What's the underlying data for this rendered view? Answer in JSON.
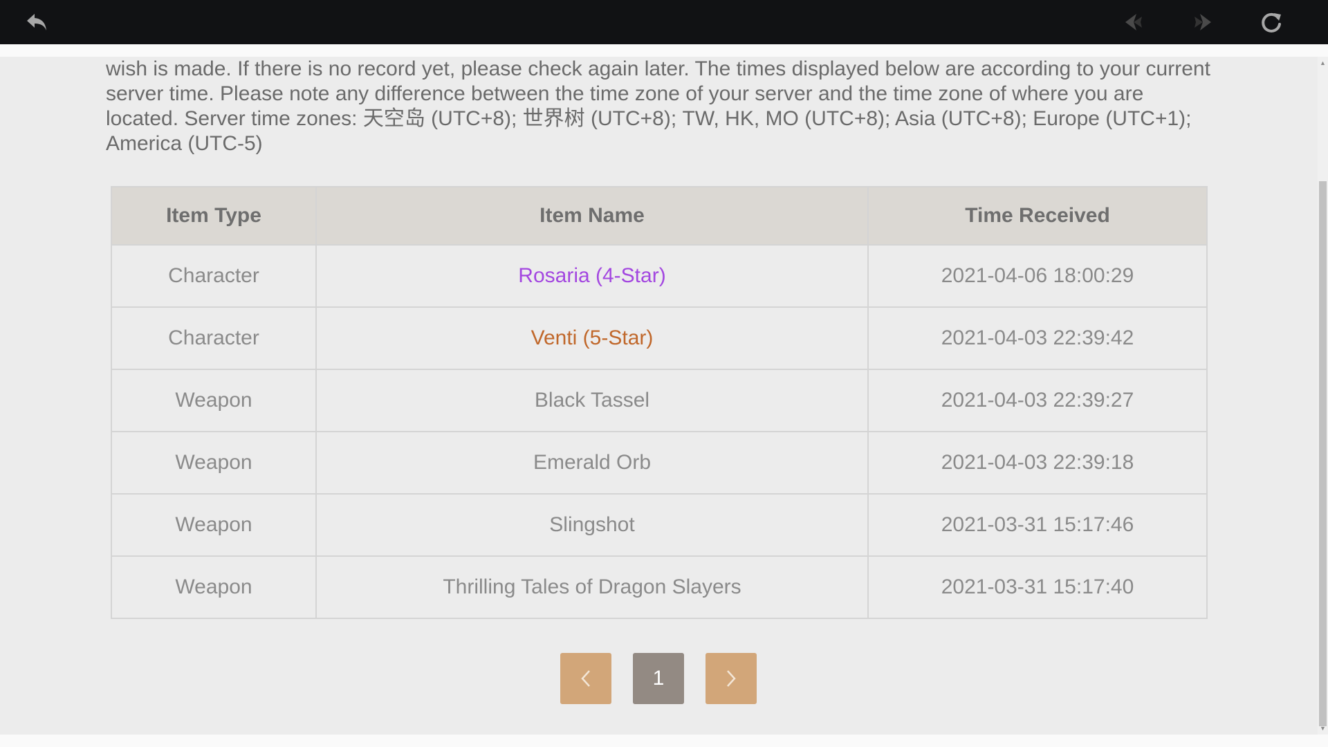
{
  "toolbar": {
    "back_icon": "back-arrow-icon",
    "prev_icon": "arrow-left-icon",
    "next_icon": "arrow-right-icon",
    "reload_icon": "reload-icon",
    "icon_color": "#a7a7a7",
    "bar_color": "#111214"
  },
  "intro_text": "wish is made. If there is no record yet, please check again later. The times displayed below are according to your current server time. Please note any difference between the time zone of your server and the time zone of where you are located. Server time zones: 天空岛 (UTC+8); 世界树 (UTC+8); TW, HK, MO (UTC+8); Asia (UTC+8); Europe (UTC+1); America (UTC-5)",
  "table": {
    "headers": [
      "Item Type",
      "Item Name",
      "Time Received"
    ],
    "rows": [
      {
        "type": "Character",
        "name": "Rosaria (4-Star)",
        "time": "2021-04-06 18:00:29",
        "rarity_color": "#a347e0"
      },
      {
        "type": "Character",
        "name": "Venti (5-Star)",
        "time": "2021-04-03 22:39:42",
        "rarity_color": "#c0672a"
      },
      {
        "type": "Weapon",
        "name": "Black Tassel",
        "time": "2021-04-03 22:39:27",
        "rarity_color": "#8a8a8a"
      },
      {
        "type": "Weapon",
        "name": "Emerald Orb",
        "time": "2021-04-03 22:39:18",
        "rarity_color": "#8a8a8a"
      },
      {
        "type": "Weapon",
        "name": "Slingshot",
        "time": "2021-03-31 15:17:46",
        "rarity_color": "#8a8a8a"
      },
      {
        "type": "Weapon",
        "name": "Thrilling Tales of Dragon Slayers",
        "time": "2021-03-31 15:17:40",
        "rarity_color": "#8a8a8a"
      }
    ]
  },
  "pagination": {
    "current_page": "1",
    "prev_icon": "chevron-left-icon",
    "next_icon": "chevron-right-icon",
    "nav_color": "#d2a679",
    "current_color": "#938a83"
  }
}
